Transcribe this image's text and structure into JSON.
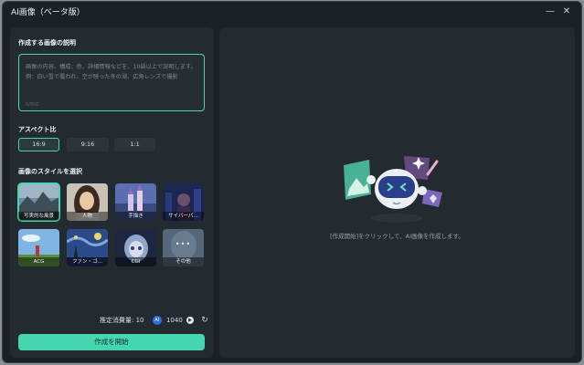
{
  "window": {
    "title": "AI画像（ベータ版）",
    "minimize_glyph": "—",
    "close_glyph": "✕"
  },
  "left": {
    "description_label": "作成する画像の説明",
    "description_placeholder": "画像の内容、構成、色、詳細情報などを、10語以上で説明します。例：白い雪で覆われ、空が映った冬の湖、広角レンズで撮影",
    "description_counter": "0/800",
    "aspect_label": "アスペクト比",
    "aspect_options": [
      {
        "label": "16:9",
        "selected": true
      },
      {
        "label": "9:16",
        "selected": false
      },
      {
        "label": "1:1",
        "selected": false
      }
    ],
    "style_label": "画像のスタイルを選択",
    "styles": [
      {
        "label": "写実的な風景",
        "selected": true
      },
      {
        "label": "人物",
        "selected": false
      },
      {
        "label": "手描き",
        "selected": false
      },
      {
        "label": "サイバーパ…",
        "selected": false
      },
      {
        "label": "ACG",
        "selected": false
      },
      {
        "label": "ファン・ゴ…",
        "selected": false
      },
      {
        "label": "CGI",
        "selected": false
      },
      {
        "label": "その他",
        "selected": false
      }
    ],
    "more_dots": "•••",
    "cost_label": "推定消費量: 10",
    "ai_badge": "AI",
    "credits": "1040",
    "create_button": "作成を開始"
  },
  "right": {
    "hint": "[作成開始]をクリックして、AI画像を作成します。"
  },
  "colors": {
    "accent": "#45d6b0",
    "panel": "#232a30",
    "background": "#1c2126"
  }
}
